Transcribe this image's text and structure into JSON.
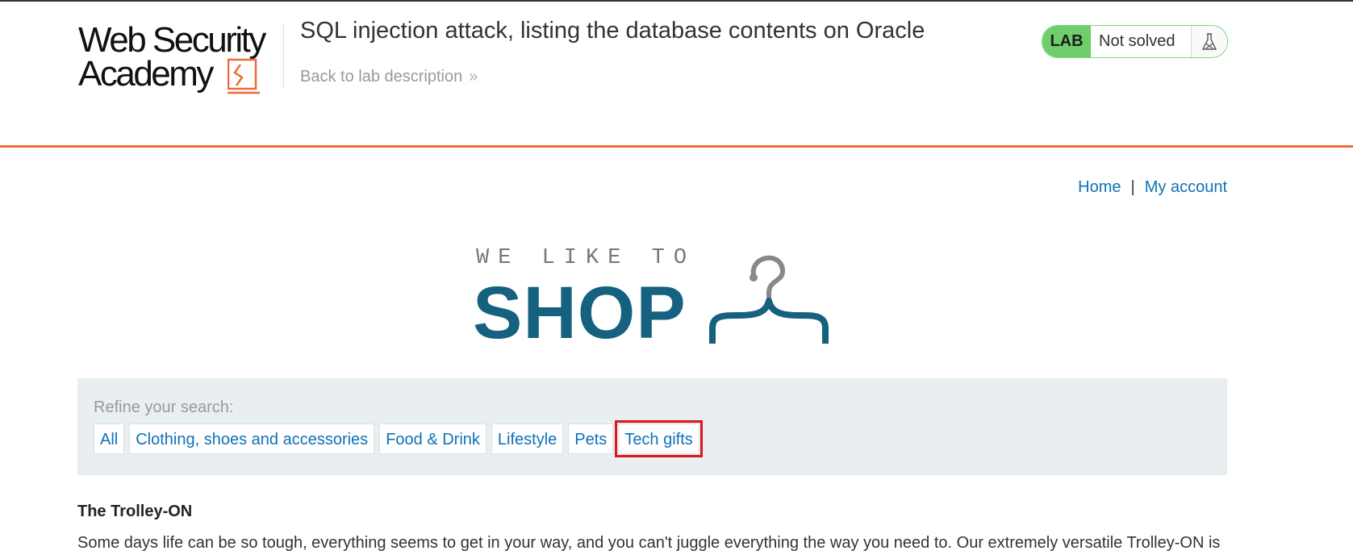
{
  "header": {
    "logo_line1": "Web Security",
    "logo_line2": "Academy",
    "lab_title": "SQL injection attack, listing the database contents on Oracle",
    "back_link": "Back to lab description",
    "back_chevron": "»",
    "lab_badge": "LAB",
    "lab_status": "Not solved",
    "flask_icon": "flask-icon"
  },
  "nav": {
    "home": "Home",
    "separator": "|",
    "my_account": "My account"
  },
  "shop_logo": {
    "tagline": "WE LIKE TO",
    "word": "SHOP",
    "icon": "hanger-icon"
  },
  "filters": {
    "label": "Refine your search:",
    "items": [
      "All",
      "Clothing, shoes and accessories",
      "Food & Drink",
      "Lifestyle",
      "Pets",
      "Tech gifts"
    ],
    "highlighted": "Tech gifts"
  },
  "product": {
    "title": "The Trolley-ON",
    "description": "Some days life can be so tough, everything seems to get in your way, and you can't juggle everything the way you need to. Our extremely versatile Trolley-ON is"
  },
  "colors": {
    "accent_orange": "#ee6a3a",
    "link_blue": "#0e71b8",
    "lab_green": "#6fce6b",
    "shop_blue": "#15617f",
    "highlight_red": "#e0141e"
  }
}
